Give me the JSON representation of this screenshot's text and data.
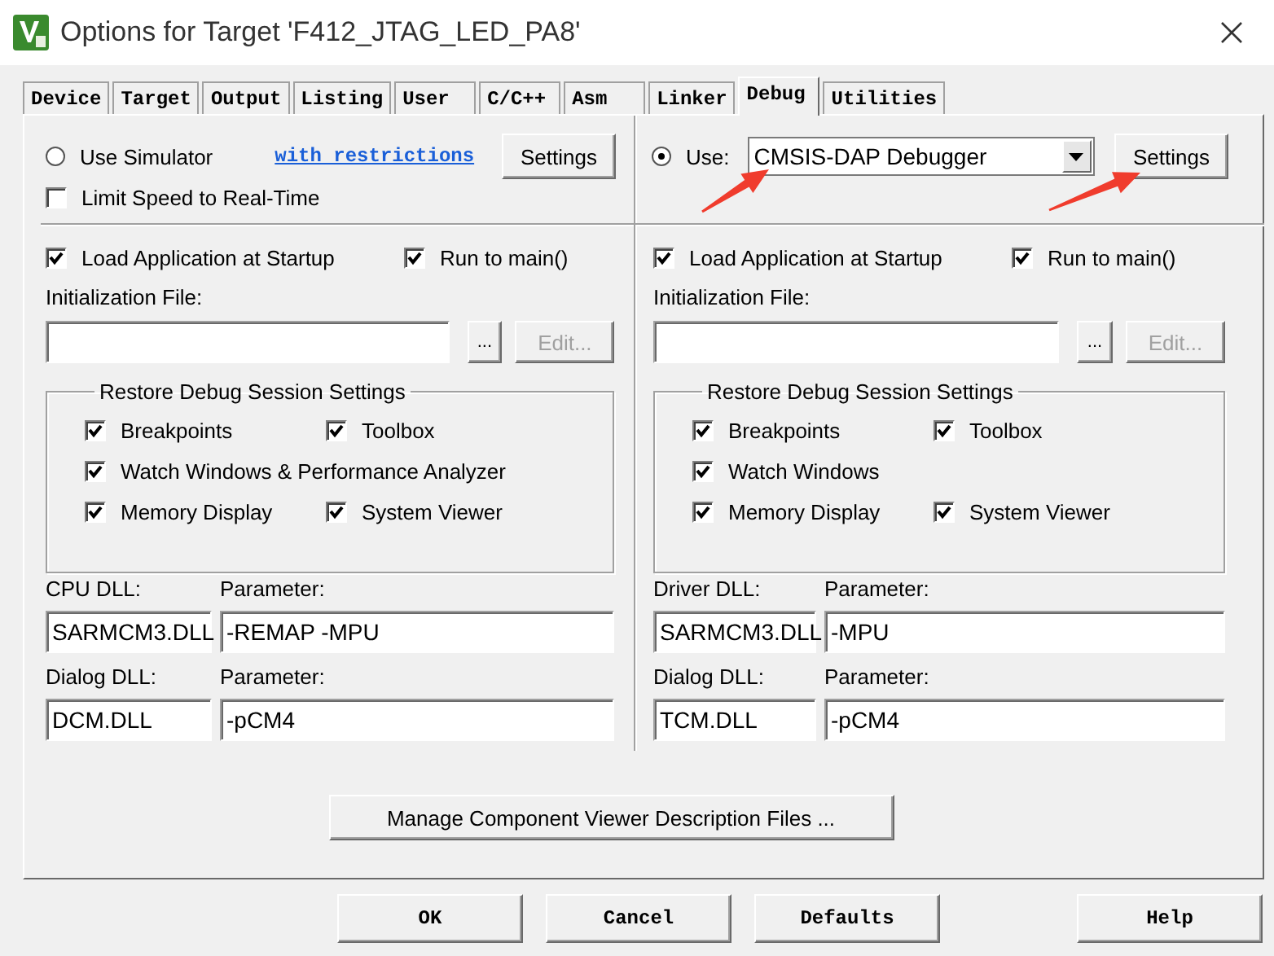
{
  "window": {
    "title": "Options for Target 'F412_JTAG_LED_PA8'"
  },
  "tabs": [
    {
      "label": "Device",
      "selected": false
    },
    {
      "label": "Target",
      "selected": false
    },
    {
      "label": "Output",
      "selected": false
    },
    {
      "label": "Listing",
      "selected": false
    },
    {
      "label": "User",
      "selected": false
    },
    {
      "label": "C/C++",
      "selected": false
    },
    {
      "label": "Asm",
      "selected": false
    },
    {
      "label": "Linker",
      "selected": false
    },
    {
      "label": "Debug",
      "selected": true
    },
    {
      "label": "Utilities",
      "selected": false
    }
  ],
  "sides": [
    {
      "mode": {
        "label": "Use Simulator",
        "selected": false
      },
      "link": "with restrictions",
      "settings": "Settings",
      "limit": {
        "label": "Limit Speed to Real-Time",
        "checked": false
      },
      "load": {
        "label": "Load Application at Startup",
        "checked": true
      },
      "run_main": {
        "label": "Run to main()",
        "checked": true
      },
      "init_label": "Initialization File:",
      "browse": "...",
      "edit": {
        "label": "Edit...",
        "disabled": true
      },
      "restore": {
        "title": "Restore Debug Session Settings",
        "rows": [
          [
            {
              "label": "Breakpoints",
              "checked": true
            },
            {
              "label": "Toolbox",
              "checked": true
            }
          ],
          [
            {
              "label": "Watch Windows & Performance Analyzer",
              "checked": true
            }
          ],
          [
            {
              "label": "Memory Display",
              "checked": true
            },
            {
              "label": "System Viewer",
              "checked": true
            }
          ]
        ]
      },
      "dlls": [
        {
          "label": "CPU DLL:",
          "value": "SARMCM3.DLL",
          "param_label": "Parameter:",
          "param": "-REMAP -MPU"
        },
        {
          "label": "Dialog DLL:",
          "value": "DCM.DLL",
          "param_label": "Parameter:",
          "param": "-pCM4"
        }
      ]
    },
    {
      "mode": {
        "label": "Use:",
        "selected": true
      },
      "driver": "CMSIS-DAP Debugger",
      "settings": "Settings",
      "load": {
        "label": "Load Application at Startup",
        "checked": true
      },
      "run_main": {
        "label": "Run to main()",
        "checked": true
      },
      "init_label": "Initialization File:",
      "browse": "...",
      "edit": {
        "label": "Edit...",
        "disabled": true
      },
      "restore": {
        "title": "Restore Debug Session Settings",
        "rows": [
          [
            {
              "label": "Breakpoints",
              "checked": true
            },
            {
              "label": "Toolbox",
              "checked": true
            }
          ],
          [
            {
              "label": "Watch Windows",
              "checked": true
            }
          ],
          [
            {
              "label": "Memory Display",
              "checked": true
            },
            {
              "label": "System Viewer",
              "checked": true
            }
          ]
        ]
      },
      "dlls": [
        {
          "label": "Driver DLL:",
          "value": "SARMCM3.DLL",
          "param_label": "Parameter:",
          "param": "-MPU"
        },
        {
          "label": "Dialog DLL:",
          "value": "TCM.DLL",
          "param_label": "Parameter:",
          "param": "-pCM4"
        }
      ]
    }
  ],
  "manage_button": "Manage Component Viewer Description Files ...",
  "buttons": [
    "OK",
    "Cancel",
    "Defaults",
    "Help"
  ]
}
